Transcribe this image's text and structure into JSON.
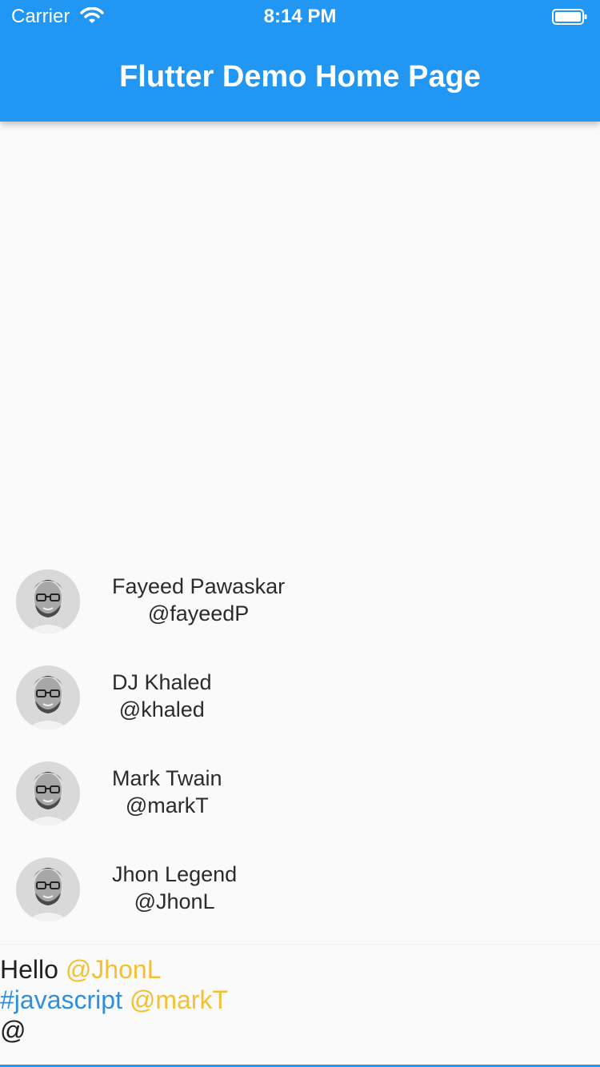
{
  "status_bar": {
    "carrier": "Carrier",
    "time": "8:14 PM",
    "wifi_icon": "wifi-icon",
    "battery_icon": "battery-icon"
  },
  "app_bar": {
    "title": "Flutter Demo Home Page",
    "color": "#2196f3"
  },
  "users": [
    {
      "name": "Fayeed Pawaskar",
      "handle": "@fayeedP"
    },
    {
      "name": "DJ Khaled",
      "handle": "@khaled"
    },
    {
      "name": "Mark Twain",
      "handle": "@markT"
    },
    {
      "name": "Jhon Legend",
      "handle": "@JhonL"
    }
  ],
  "composer": {
    "line1": {
      "plain": "Hello ",
      "mention": "@JhonL"
    },
    "line2": {
      "hashtag": "#javascript",
      "space": " ",
      "mention": "@markT"
    },
    "line3": {
      "plain": "@"
    },
    "mention_color": "#f2c133",
    "hashtag_color": "#2f8fdc"
  }
}
